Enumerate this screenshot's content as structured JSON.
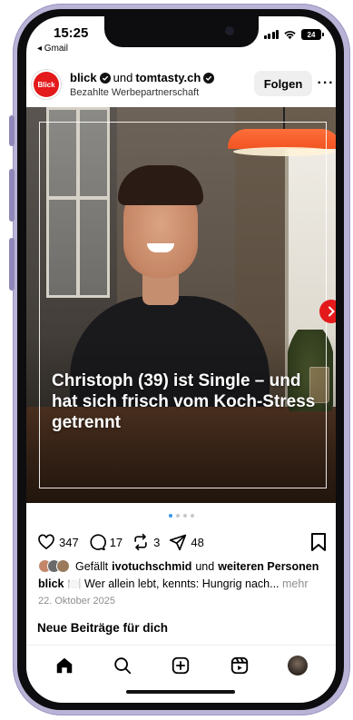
{
  "status_bar": {
    "time": "15:25",
    "back_label": "◂ Gmail",
    "battery": "24"
  },
  "post": {
    "author_primary": "blick",
    "connector": "und",
    "author_secondary": "tomtasty.ch",
    "sponsor_label": "Bezahlte Werbepartnerschaft",
    "avatar_text": "Blick",
    "follow_label": "Folgen",
    "more_label": "···",
    "headline": "Christoph (39) ist Single – und hat sich frisch vom Koch-Stress getrennt",
    "carousel": {
      "count": 4,
      "active_index": 0
    }
  },
  "actions": {
    "likes_count": "347",
    "comments_count": "17",
    "reposts_count": "3",
    "shares_count": "48"
  },
  "likes_line": {
    "prefix": "Gefällt",
    "user": "ivotuchschmid",
    "middle": "und",
    "others": "weiteren Personen"
  },
  "caption": {
    "author": "blick",
    "emoji": "🍽️",
    "text": "Wer allein lebt, kennts: Hungrig nach...",
    "more": "mehr"
  },
  "date": "22. Oktober 2025",
  "section_title": "Neue Beiträge für dich",
  "colors": {
    "brand_red": "#e4191b",
    "accent_blue": "#3897f0",
    "frame_purple": "#b9b3d6"
  },
  "nav": {
    "items": [
      "home-icon",
      "search-icon",
      "create-icon",
      "reels-icon",
      "profile-avatar"
    ]
  }
}
